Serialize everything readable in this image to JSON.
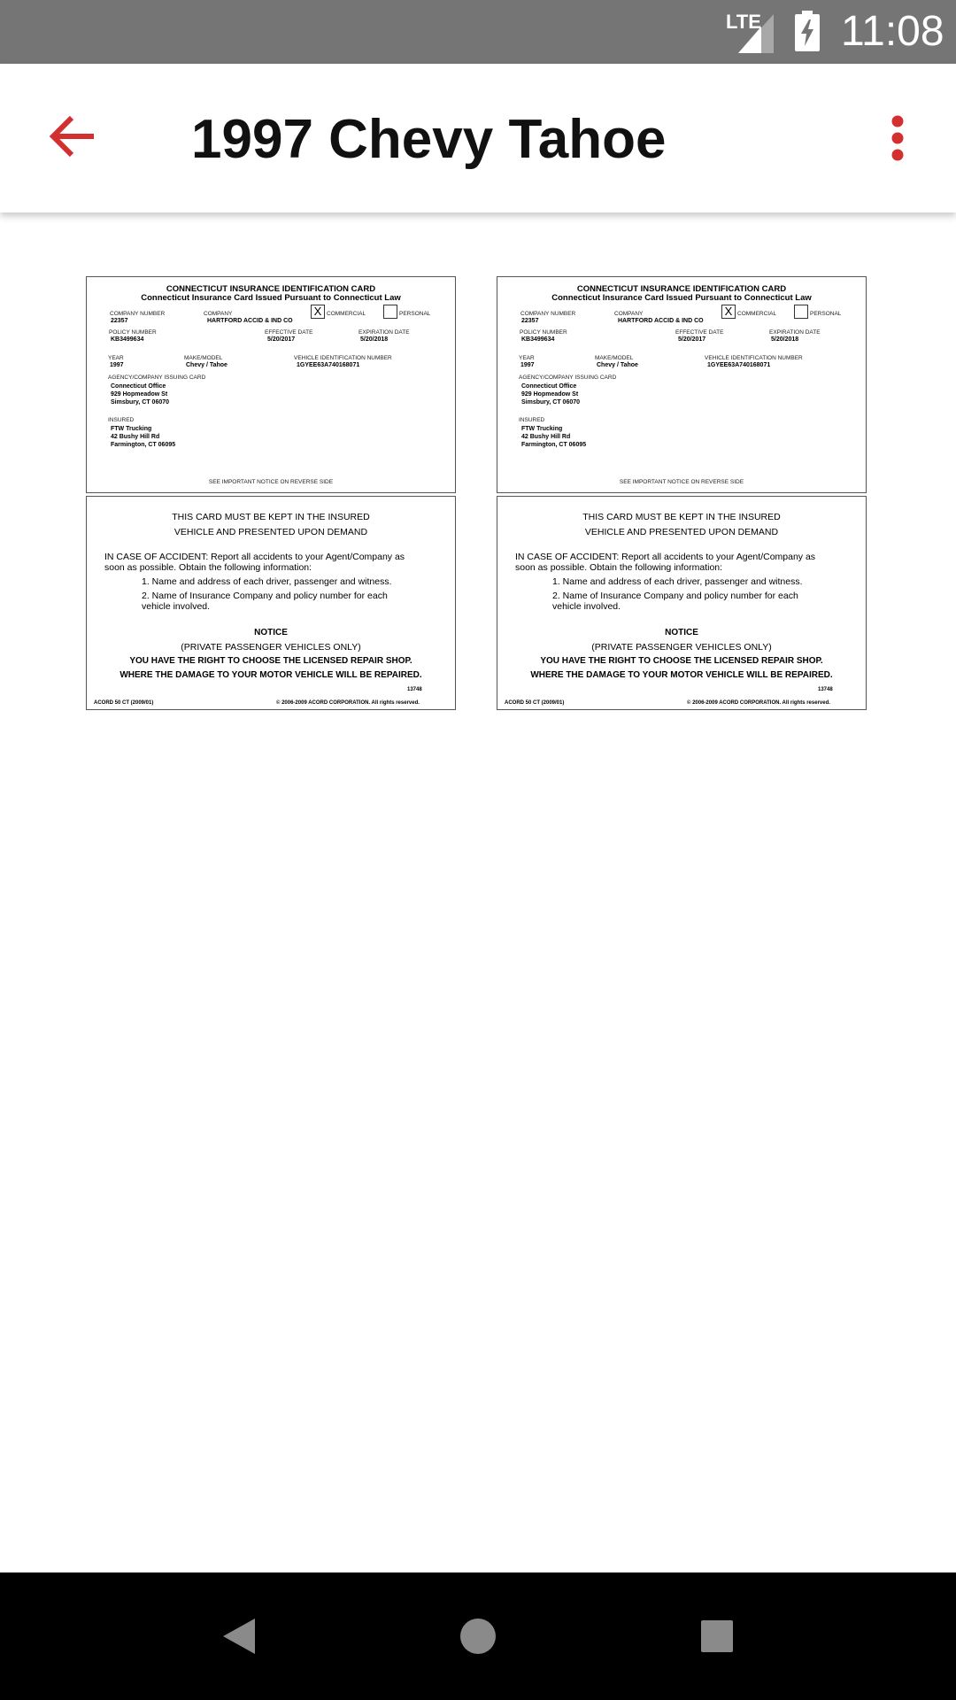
{
  "status_bar": {
    "network": "LTE",
    "time": "11:08"
  },
  "app_bar": {
    "title": "1997 Chevy Tahoe",
    "accent_color": "#D32F2F"
  },
  "card": {
    "front": {
      "heading": "CONNECTICUT INSURANCE IDENTIFICATION CARD",
      "subheading": "Connecticut Insurance Card Issued Pursuant to Connecticut Law",
      "company_number_label": "COMPANY NUMBER",
      "company_number": "22357",
      "company_label": "COMPANY",
      "company": "HARTFORD ACCID & IND CO",
      "commercial_label": "COMMERCIAL",
      "commercial_mark": "X",
      "personal_label": "PERSONAL",
      "policy_number_label": "POLICY NUMBER",
      "policy_number": "KB3499634",
      "effective_date_label": "EFFECTIVE DATE",
      "effective_date": "5/20/2017",
      "expiration_date_label": "EXPIRATION DATE",
      "expiration_date": "5/20/2018",
      "year_label": "YEAR",
      "year": "1997",
      "make_model_label": "MAKE/MODEL",
      "make_model": "Chevy / Tahoe",
      "vin_label": "VEHICLE IDENTIFICATION NUMBER",
      "vin": "1GYEE63A740168071",
      "agency_label": "AGENCY/COMPANY ISSUING CARD",
      "agency_line1": "Connecticut Office",
      "agency_line2": "929 Hopmeadow St",
      "agency_line3": "Simsbury, CT 06070",
      "insured_label": "INSURED",
      "insured_line1": "FTW Trucking",
      "insured_line2": "42 Bushy Hill Rd",
      "insured_line3": "Farmington, CT 06095",
      "footer_notice": "SEE IMPORTANT NOTICE ON REVERSE SIDE"
    },
    "back": {
      "line1": "THIS CARD MUST BE KEPT IN THE INSURED",
      "line2": "VEHICLE AND PRESENTED UPON DEMAND",
      "accident_line1": "IN CASE OF ACCIDENT:  Report all accidents to your Agent/Company as",
      "accident_line2": "soon as possible. Obtain the following information:",
      "item1": "1. Name and address of each driver, passenger and witness.",
      "item2a": "2. Name of Insurance Company and policy number for each",
      "item2b": "vehicle involved.",
      "notice_title": "NOTICE",
      "notice_sub": "(PRIVATE PASSENGER VEHICLES ONLY)",
      "notice_line1": "YOU HAVE THE RIGHT TO CHOOSE THE LICENSED REPAIR SHOP.",
      "notice_line2": "WHERE THE DAMAGE TO YOUR MOTOR VEHICLE WILL BE REPAIRED.",
      "code": "13748",
      "form_id": "ACORD 50 CT (2009/01)",
      "copyright": "© 2006-2009 ACORD CORPORATION. All rights reserved."
    }
  },
  "nav_bar": {
    "back": "back-triangle",
    "home": "home-circle",
    "recents": "recents-square"
  }
}
